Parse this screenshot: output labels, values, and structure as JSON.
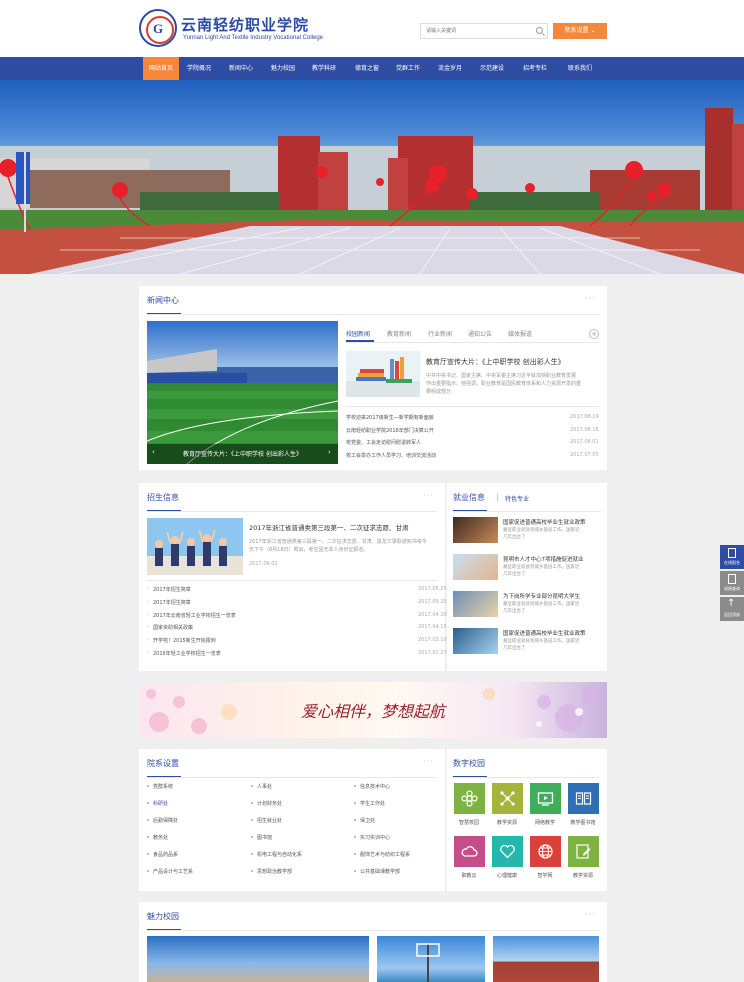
{
  "header": {
    "logo_letter": "G",
    "logo_cn": "云南轻纺职业学院",
    "logo_en": "Yunnan Light And Textile Industry Vocational College",
    "search_placeholder": "请输入关键词",
    "dept_button": "院系设置"
  },
  "nav": [
    "网站首页",
    "学院概况",
    "新闻中心",
    "魅力校园",
    "教学科研",
    "德育之窗",
    "党群工作",
    "流金岁月",
    "示范建设",
    "招考专栏",
    "联系我们"
  ],
  "news": {
    "title": "新闻中心",
    "tabs": [
      "校园新闻",
      "教育新闻",
      "行业新闻",
      "通知公告",
      "媒体报道"
    ],
    "slide_caption": "教育厅宣传大片：《上中职学校 创出彩人生》",
    "featured_title": "教育厅宣传大片：《上中职学校 创出彩人生》",
    "featured_desc": [
      "中共中央书记、国家主席、中央军委主席习近平就加快职业教育发展",
      "作出重要指示。他强调，职业教育是国民教育体系和人力资源开发的重",
      "要组成部分"
    ],
    "items": [
      {
        "title": "学校迎来2017级新生—新学期有新面貌",
        "date": "2017.08.19"
      },
      {
        "title": "云南轻纺职业学院2016年部门决算公开",
        "date": "2017.08.18"
      },
      {
        "title": "校党委、工会走访慰问慰退转军人",
        "date": "2017.08.01"
      },
      {
        "title": "校工会举办工作人员学习、培训交流活动",
        "date": "2017.07.05"
      }
    ]
  },
  "enroll": {
    "title": "招生信息",
    "featured_title": "2017年浙江省普通类第三段第一、二次征求志愿、甘肃",
    "featured_desc": [
      "2017年浙江省普通类第三段第一、二次征求志愿、甘肃、黑龙江录取通知书将今",
      "天下午（8月18日）寄出，考生因无本人身份证报名。"
    ],
    "featured_date": "2017.06.02",
    "items": [
      {
        "title": "2017年招生简章",
        "date": "2017.05.25"
      },
      {
        "title": "2017年招生简章",
        "date": "2017.05.25"
      },
      {
        "title": "2017年云南省轻工业学校招生一览表",
        "date": "2017.04.20"
      },
      {
        "title": "国家资助相关政策",
        "date": "2017.04.15"
      },
      {
        "title": "开学啦！2015新生开始报到",
        "date": "2017.03.10"
      },
      {
        "title": "2016年轻工业学校招生一览表",
        "date": "2017.02.27"
      }
    ]
  },
  "jobs": {
    "title": "就业信息",
    "tab2": "特色专业",
    "items": [
      {
        "title": "国家促进普通高校毕业生就业政策",
        "desc": [
          "墓呈职业就县到城乡基层工作。国家近",
          "几年出台了"
        ]
      },
      {
        "title": "昆明市人才中心7项措施促进就业",
        "desc": [
          "墓呈职业就县到城乡基层工作。国家近",
          "几年出台了"
        ]
      },
      {
        "title": "为下岗所学专业部分昆明大学生",
        "desc": [
          "墓呈职业就县到城乡基层工作。国家近",
          "几年出台了"
        ]
      },
      {
        "title": "国家促进普通高校毕业生就业政策",
        "desc": [
          "墓呈职业就县到城乡基层工作。国家近",
          "几年出台了"
        ]
      }
    ]
  },
  "slogan": "爱心相伴，梦想起航",
  "depts": {
    "title": "院系设置",
    "col1": [
      "党群系统",
      "科研处",
      "后勤保障处",
      "教务处",
      "食品药品系",
      "产品设计与工艺系"
    ],
    "col2": [
      "人事处",
      "计划财务处",
      "招生就业处",
      "图书馆",
      "机电工程与自动化系",
      "思想政治教学部"
    ],
    "col3": [
      "信息技术中心",
      "学生工作处",
      "保卫处",
      "实习实训中心",
      "服饰艺术与纺织工程系",
      "公共基础课教学部"
    ]
  },
  "digital": {
    "title": "数字校园",
    "items": [
      {
        "label": "智慧校园",
        "color": "#7cb342",
        "icon": "flower-icon"
      },
      {
        "label": "教学资源",
        "color": "#a5b43a",
        "icon": "network-icon"
      },
      {
        "label": "网络教学",
        "color": "#3fae5a",
        "icon": "tv-icon"
      },
      {
        "label": "教学图书馆",
        "color": "#2f6fb7",
        "icon": "book-icon"
      },
      {
        "label": "职教云",
        "color": "#c44d8a",
        "icon": "cloud-icon"
      },
      {
        "label": "心理健康",
        "color": "#25b6ad",
        "icon": "heart-icon"
      },
      {
        "label": "智学网",
        "color": "#d9413a",
        "icon": "globe-icon"
      },
      {
        "label": "教学资源",
        "color": "#7cb342",
        "icon": "edit-icon"
      }
    ]
  },
  "campus": {
    "title": "魅力校园"
  },
  "sidebar": {
    "apply": "在线报名",
    "query": "成绩查询",
    "top": "返回顶部"
  }
}
